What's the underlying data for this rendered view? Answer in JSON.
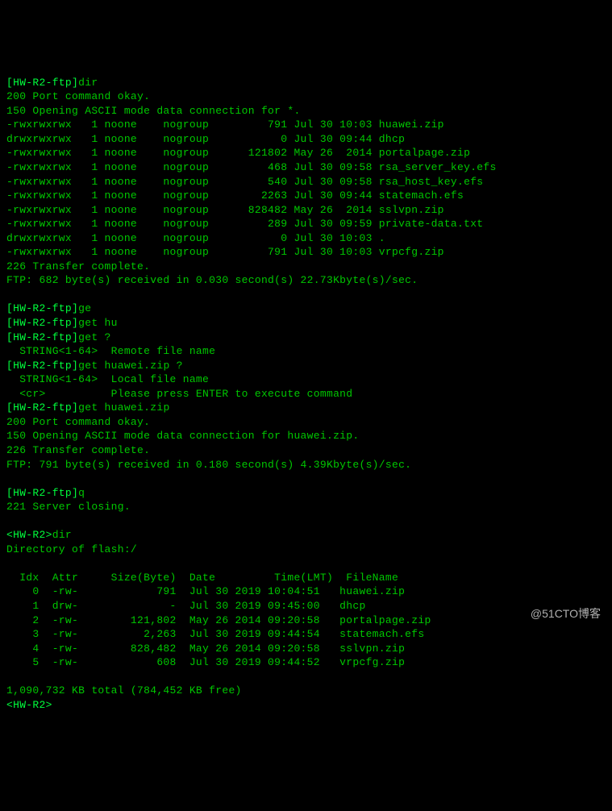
{
  "ftp_prompt": "[HW-R2-ftp]",
  "local_prompt": "<HW-R2>",
  "cmd_dir": "dir",
  "resp_port_ok": "200 Port command okay.",
  "resp_open_any": "150 Opening ASCII mode data connection for *.",
  "listing": [
    {
      "perm": "-rwxrwxrwx",
      "ln": "1",
      "own": "noone",
      "grp": "nogroup",
      "size": "791",
      "date": "Jul 30 10:03",
      "name": "huawei.zip"
    },
    {
      "perm": "drwxrwxrwx",
      "ln": "1",
      "own": "noone",
      "grp": "nogroup",
      "size": "0",
      "date": "Jul 30 09:44",
      "name": "dhcp"
    },
    {
      "perm": "-rwxrwxrwx",
      "ln": "1",
      "own": "noone",
      "grp": "nogroup",
      "size": "121802",
      "date": "May 26  2014",
      "name": "portalpage.zip"
    },
    {
      "perm": "-rwxrwxrwx",
      "ln": "1",
      "own": "noone",
      "grp": "nogroup",
      "size": "468",
      "date": "Jul 30 09:58",
      "name": "rsa_server_key.efs"
    },
    {
      "perm": "-rwxrwxrwx",
      "ln": "1",
      "own": "noone",
      "grp": "nogroup",
      "size": "540",
      "date": "Jul 30 09:58",
      "name": "rsa_host_key.efs"
    },
    {
      "perm": "-rwxrwxrwx",
      "ln": "1",
      "own": "noone",
      "grp": "nogroup",
      "size": "2263",
      "date": "Jul 30 09:44",
      "name": "statemach.efs"
    },
    {
      "perm": "-rwxrwxrwx",
      "ln": "1",
      "own": "noone",
      "grp": "nogroup",
      "size": "828482",
      "date": "May 26  2014",
      "name": "sslvpn.zip"
    },
    {
      "perm": "-rwxrwxrwx",
      "ln": "1",
      "own": "noone",
      "grp": "nogroup",
      "size": "289",
      "date": "Jul 30 09:59",
      "name": "private-data.txt"
    },
    {
      "perm": "drwxrwxrwx",
      "ln": "1",
      "own": "noone",
      "grp": "nogroup",
      "size": "0",
      "date": "Jul 30 10:03",
      "name": "."
    },
    {
      "perm": "-rwxrwxrwx",
      "ln": "1",
      "own": "noone",
      "grp": "nogroup",
      "size": "791",
      "date": "Jul 30 10:03",
      "name": "vrpcfg.zip"
    }
  ],
  "resp_xfer_done": "226 Transfer complete.",
  "resp_ftp_stat1": "FTP: 682 byte(s) received in 0.030 second(s) 22.73Kbyte(s)/sec.",
  "cmd_ge": "ge",
  "cmd_get_hu": "get hu",
  "cmd_get_q": "get ?",
  "help_remote": "  STRING<1-64>  Remote file name",
  "cmd_get_hz_q": "get huawei.zip ?",
  "help_local": "  STRING<1-64>  Local file name",
  "help_cr": "  <cr>          Please press ENTER to execute command",
  "cmd_get_hz": "get huawei.zip",
  "resp_open_hz": "150 Opening ASCII mode data connection for huawei.zip.",
  "resp_ftp_stat2": "FTP: 791 byte(s) received in 0.180 second(s) 4.39Kbyte(s)/sec.",
  "cmd_q": "q",
  "resp_close": "221 Server closing.",
  "dir_of_flash": "Directory of flash:/",
  "flash_header": {
    "idx": "Idx",
    "attr": "Attr",
    "size": "Size(Byte)",
    "date": "Date",
    "time": "Time(LMT)",
    "name": "FileName"
  },
  "flash": [
    {
      "idx": "0",
      "attr": "-rw-",
      "size": "791",
      "date": "Jul 30 2019",
      "time": "10:04:51",
      "name": "huawei.zip"
    },
    {
      "idx": "1",
      "attr": "drw-",
      "size": "-",
      "date": "Jul 30 2019",
      "time": "09:45:00",
      "name": "dhcp"
    },
    {
      "idx": "2",
      "attr": "-rw-",
      "size": "121,802",
      "date": "May 26 2014",
      "time": "09:20:58",
      "name": "portalpage.zip"
    },
    {
      "idx": "3",
      "attr": "-rw-",
      "size": "2,263",
      "date": "Jul 30 2019",
      "time": "09:44:54",
      "name": "statemach.efs"
    },
    {
      "idx": "4",
      "attr": "-rw-",
      "size": "828,482",
      "date": "May 26 2014",
      "time": "09:20:58",
      "name": "sslvpn.zip"
    },
    {
      "idx": "5",
      "attr": "-rw-",
      "size": "608",
      "date": "Jul 30 2019",
      "time": "09:44:52",
      "name": "vrpcfg.zip"
    }
  ],
  "total_line": "1,090,732 KB total (784,452 KB free)",
  "watermark": "@51CTO博客"
}
